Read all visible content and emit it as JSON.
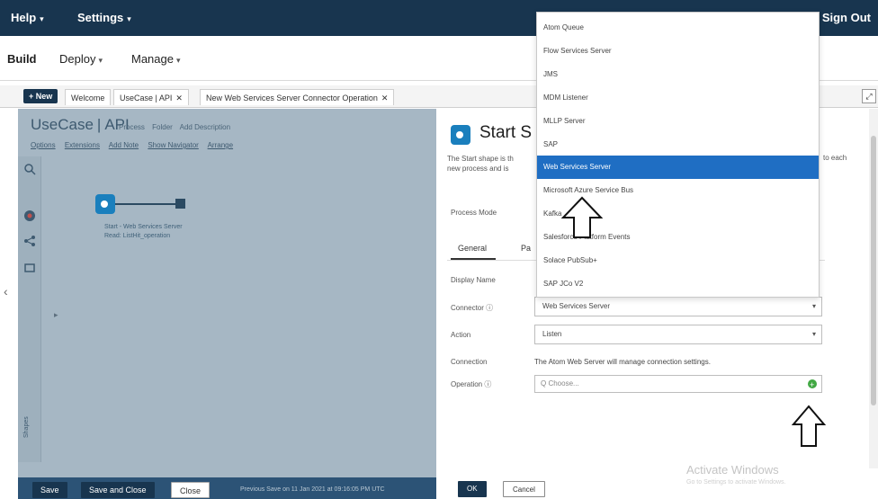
{
  "topbar": {
    "help_label": "Help",
    "settings_label": "Settings",
    "signout_label": "Sign Out"
  },
  "subnav": {
    "build_label": "Build",
    "deploy_label": "Deploy",
    "manage_label": "Manage"
  },
  "tabs": {
    "new_label": "+ New",
    "welcome": "Welcome",
    "usecase": "UseCase | API",
    "operation": "New Web Services Server Connector Operation"
  },
  "canvas": {
    "title_main": "UseCase",
    "title_sub": "API",
    "meta_1": "Process",
    "meta_2": "Folder",
    "meta_3": "Add Description",
    "links": [
      "Options",
      "Extensions",
      "Add Note",
      "Show Navigator",
      "Arrange"
    ],
    "shape_label_1": "Start - Web Services Server",
    "shape_label_2": "Read: ListHit_operation",
    "vertical_label": "Shapes",
    "buttons": {
      "save": "Save",
      "save_close": "Save and Close",
      "close": "Close"
    },
    "saved_note": "Previous Save on 11 Jan 2021 at 09:16:05 PM UTC"
  },
  "dialog": {
    "title": "Start S",
    "description_1": "The Start shape is th",
    "description_2": "new process and is",
    "description_right": "to each",
    "process_mode_label": "Process Mode",
    "tab_general": "General",
    "tab_second": "Pa",
    "display_name_label": "Display Name",
    "connector_label": "Connector",
    "connector_value": "Web Services Server",
    "action_label": "Action",
    "action_value": "Listen",
    "connection_label": "Connection",
    "connection_text": "The Atom Web Server will manage connection settings.",
    "operation_label": "Operation",
    "operation_placeholder": "Q Choose...",
    "ok_label": "OK",
    "cancel_label": "Cancel"
  },
  "dropdown": {
    "items": [
      "Atom Queue",
      "Flow Services Server",
      "JMS",
      "MDM Listener",
      "MLLP Server",
      "SAP",
      "Web Services Server",
      "Microsoft Azure Service Bus",
      "Kafka",
      "Salesforce Platform Events",
      "Solace PubSub+",
      "SAP JCo V2"
    ],
    "selected_index": 6
  },
  "watermark": {
    "title": "Activate Windows",
    "subtitle": "Go to Settings to activate Windows."
  },
  "colors": {
    "topbar": "#18354f",
    "canvas": "#a6b7c4",
    "accent": "#1a7fbd",
    "selected": "#1f6ec3"
  }
}
